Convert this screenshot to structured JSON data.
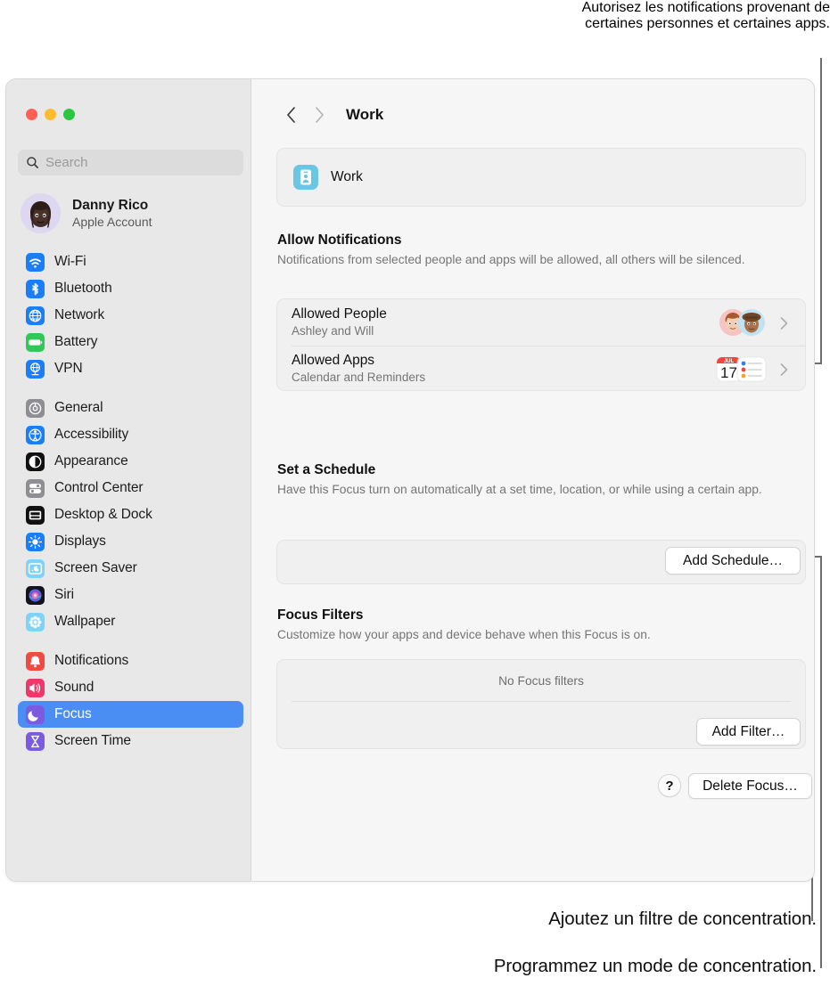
{
  "callouts": {
    "top_line1": "Autorisez les notifications provenant de",
    "top_line2": "certaines personnes et certaines apps.",
    "add_filter": "Ajoutez un filtre de concentration.",
    "add_schedule": "Programmez un mode de concentration."
  },
  "window": {
    "sidebar": {
      "search": {
        "placeholder": "Search",
        "value": "",
        "icon": "search-icon"
      },
      "account": {
        "name": "Danny Rico",
        "subtitle": "Apple Account",
        "avatar": "memoji-avatar"
      },
      "groups": [
        {
          "items": [
            {
              "label": "Wi-Fi",
              "icon": "wifi-icon",
              "selected": false
            },
            {
              "label": "Bluetooth",
              "icon": "bluetooth-icon",
              "selected": false
            },
            {
              "label": "Network",
              "icon": "network-icon",
              "selected": false
            },
            {
              "label": "Battery",
              "icon": "battery-icon",
              "selected": false
            },
            {
              "label": "VPN",
              "icon": "vpn-icon",
              "selected": false
            }
          ]
        },
        {
          "items": [
            {
              "label": "General",
              "icon": "gear-icon",
              "selected": false
            },
            {
              "label": "Accessibility",
              "icon": "accessibility-icon",
              "selected": false
            },
            {
              "label": "Appearance",
              "icon": "appearance-icon",
              "selected": false
            },
            {
              "label": "Control Center",
              "icon": "control-center-icon",
              "selected": false
            },
            {
              "label": "Desktop & Dock",
              "icon": "desktop-dock-icon",
              "selected": false
            },
            {
              "label": "Displays",
              "icon": "displays-icon",
              "selected": false
            },
            {
              "label": "Screen Saver",
              "icon": "screen-saver-icon",
              "selected": false
            },
            {
              "label": "Siri",
              "icon": "siri-icon",
              "selected": false
            },
            {
              "label": "Wallpaper",
              "icon": "wallpaper-icon",
              "selected": false
            }
          ]
        },
        {
          "items": [
            {
              "label": "Notifications",
              "icon": "notifications-icon",
              "selected": false
            },
            {
              "label": "Sound",
              "icon": "sound-icon",
              "selected": false
            },
            {
              "label": "Focus",
              "icon": "focus-icon",
              "selected": true
            },
            {
              "label": "Screen Time",
              "icon": "screen-time-icon",
              "selected": false
            }
          ]
        }
      ]
    },
    "toolbar": {
      "back_icon": "chevron-left-icon",
      "forward_icon": "chevron-right-icon",
      "title": "Work"
    },
    "focus_header": {
      "name": "Work",
      "icon": "work-focus-icon"
    },
    "allow_notifications": {
      "title": "Allow Notifications",
      "description": "Notifications from selected people and apps will be allowed, all others will be silenced.",
      "rows": [
        {
          "title": "Allowed People",
          "subtitle": "Ashley and Will",
          "accessory": "memoji-pair",
          "chevron": "chevron-right-icon"
        },
        {
          "title": "Allowed Apps",
          "subtitle": "Calendar and Reminders",
          "accessory": "calendar-reminders-pair",
          "chevron": "chevron-right-icon"
        }
      ]
    },
    "set_schedule": {
      "title": "Set a Schedule",
      "description": "Have this Focus turn on automatically at a set time, location, or while using a certain app.",
      "add_button": "Add Schedule…"
    },
    "focus_filters": {
      "title": "Focus Filters",
      "description": "Customize how your apps and device behave when this Focus is on.",
      "empty_text": "No Focus filters",
      "add_button": "Add Filter…"
    },
    "footer": {
      "help_label": "?",
      "delete_button": "Delete Focus…"
    }
  },
  "colors": {
    "accent": "#4a8ef4",
    "sidebar_bg": "#e8e8e8",
    "content_bg": "#f6f6f6",
    "card_bg": "#f0f0f0",
    "callout_line": "#6e6e6e"
  }
}
